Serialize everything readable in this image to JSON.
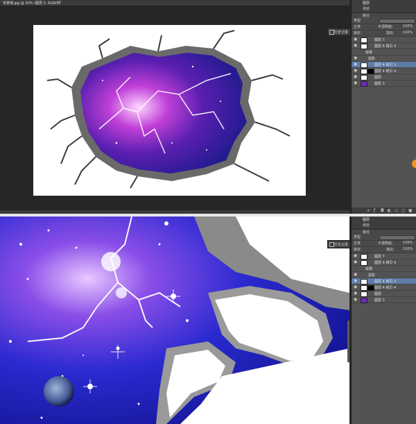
{
  "top": {
    "doc_tab_title": "背景墙.jpg @ 50% (图层 5, RGB/8)",
    "close_glyph": "×",
    "history_button": "历史记录",
    "panel": {
      "header_tab": "图层",
      "header_tab2": "通道",
      "sub_label": "路径",
      "kind_label": "类型",
      "blend_mode": "正常",
      "opacity_label": "不透明度:",
      "opacity_value": "100%",
      "lock_label": "锁定:",
      "fill_label": "填充:",
      "fill_value": "100%",
      "layers": [
        {
          "label": "图层 7",
          "selected": false
        },
        {
          "label": "图层 6 拷贝 4",
          "selected": false
        },
        {
          "label": "效果",
          "selected": false
        },
        {
          "label": "投影",
          "selected": false
        },
        {
          "label": "图层 4 拷贝 3",
          "selected": true
        },
        {
          "label": "图层 4 拷贝 4",
          "selected": false
        },
        {
          "label": "图层",
          "selected": false
        },
        {
          "label": "图层 3",
          "selected": false
        }
      ],
      "bottom_icons": [
        "link-icon",
        "fx-icon",
        "mask-icon",
        "adjust-icon",
        "group-icon",
        "new-layer-icon",
        "trash-icon"
      ]
    }
  },
  "bottom": {
    "history_button": "历史记录",
    "panel": {
      "header_tab": "图层",
      "header_tab2": "通道",
      "sub_label": "路径",
      "kind_label": "类型",
      "blend_mode": "正常",
      "opacity_label": "不透明度:",
      "opacity_value": "100%",
      "lock_label": "锁定:",
      "fill_label": "填充:",
      "fill_value": "100%",
      "layers": [
        {
          "label": "图层 7",
          "selected": false
        },
        {
          "label": "图层 6 拷贝 4",
          "selected": false
        },
        {
          "label": "效果",
          "selected": false
        },
        {
          "label": "投影",
          "selected": false
        },
        {
          "label": "图层 4 拷贝 3",
          "selected": true
        },
        {
          "label": "图层 4 拷贝 4",
          "selected": false
        },
        {
          "label": "图层",
          "selected": false
        },
        {
          "label": "图层 3",
          "selected": false
        }
      ]
    }
  },
  "colors": {
    "accent_selection": "#5d7ca8",
    "galaxy_purple": "#8a2be2",
    "galaxy_blue": "#2222cc",
    "orange_tab": "#f7941d"
  }
}
